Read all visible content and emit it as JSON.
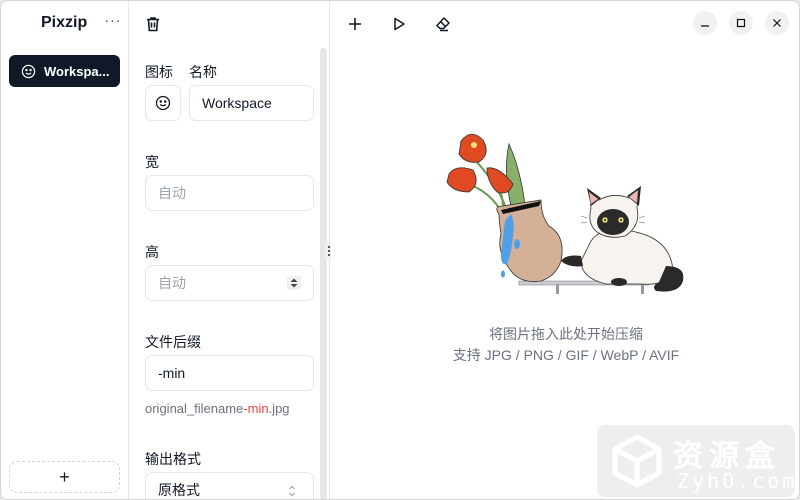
{
  "app": {
    "title": "Pixzip",
    "more_icon": "ellipsis-icon"
  },
  "sidebar": {
    "workspaces": [
      {
        "label": "Workspa...",
        "full_name": "Workspace",
        "icon": "smiley-icon",
        "active": true
      }
    ],
    "add_label": "+"
  },
  "panel": {
    "delete_icon": "trash-icon",
    "icon_label": "图标",
    "name_label": "名称",
    "name_value": "Workspace",
    "width_label": "宽",
    "width_placeholder": "自动",
    "height_label": "高",
    "height_placeholder": "自动",
    "suffix_label": "文件后缀",
    "suffix_value": "-min",
    "preview": {
      "prefix": "original_filename",
      "suffix": "-min",
      "ext": ".jpg"
    },
    "format_label": "输出格式",
    "format_value": "原格式"
  },
  "toolbar": {
    "add_icon": "plus-icon",
    "run_icon": "play-icon",
    "clear_icon": "eraser-icon"
  },
  "window_controls": {
    "minimize": "minimize-icon",
    "maximize": "maximize-icon",
    "close": "close-icon"
  },
  "dropzone": {
    "line1": "将图片拖入此处开始压缩",
    "line2": "支持 JPG / PNG / GIF / WebP / AVIF"
  },
  "watermark": {
    "title": "资源盒",
    "sub": "ZyhO.com"
  },
  "colors": {
    "accent": "#111827",
    "highlight": "#ef4444",
    "muted": "#6b7280",
    "border": "#e5e7eb"
  }
}
